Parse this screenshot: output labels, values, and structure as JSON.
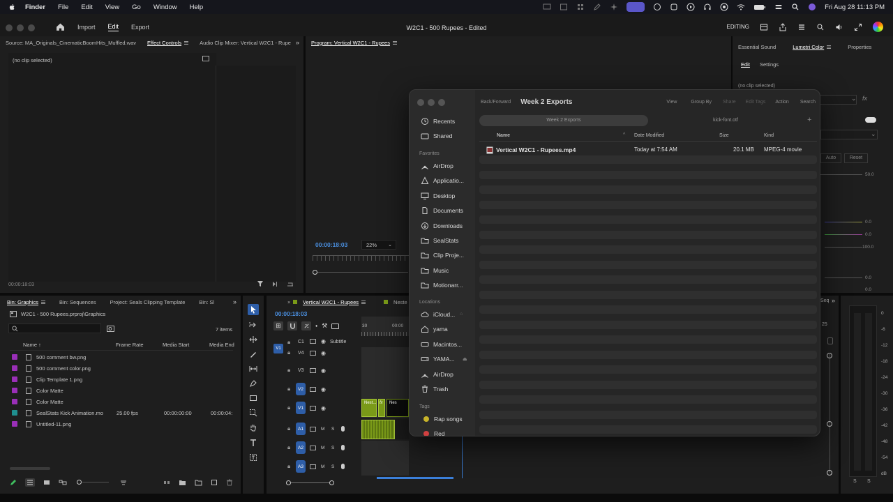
{
  "menubar": {
    "app": "Finder",
    "items": [
      "File",
      "Edit",
      "View",
      "Go",
      "Window",
      "Help"
    ],
    "clock": "Fri Aug 28  11:13 PM"
  },
  "header": {
    "nav": [
      "Import",
      "Edit",
      "Export"
    ],
    "active_nav": "Edit",
    "title": "W2C1 - 500 Rupees - Edited",
    "workspace": "EDITING"
  },
  "source_panel": {
    "tabs": [
      "Source: MA_Originals_CinematicBoomHits_Muffled.wav",
      "Effect Controls",
      "Audio Clip Mixer: Vertical W2C1 - Rupe"
    ],
    "active_tab": "Effect Controls",
    "no_clip": "(no clip selected)",
    "timecode": "00:00:18:03"
  },
  "program_panel": {
    "tab": "Program: Vertical W2C1 - Rupees",
    "timecode": "00:00:18:03",
    "zoom": "22%"
  },
  "lumetri_panel": {
    "tabs": [
      "Essential Sound",
      "Lumetri Color",
      "Properties"
    ],
    "active_tab": "Lumetri Color",
    "subtabs": [
      "Edit",
      "Settings"
    ],
    "no_clip": "(no clip selected)",
    "values": [
      "50.0",
      "0.0",
      "0.0",
      "100.0",
      "0.0",
      "0.0"
    ],
    "buttons": [
      "Auto",
      "Reset"
    ]
  },
  "project_panel": {
    "tabs": [
      "Bin: Graphics",
      "Bin: Sequences",
      "Project: Seals Clipping Template",
      "Bin: Sl"
    ],
    "path": "W2C1 - 500 Rupees.prproj\\Graphics",
    "item_count": "7 items",
    "columns": [
      "Name",
      "Frame Rate",
      "Media Start",
      "Media End"
    ],
    "rows": [
      {
        "name": "500 comment bw.png",
        "fps": "",
        "start": "",
        "end": "",
        "color": "#9a2fb8"
      },
      {
        "name": "500 comment color.png",
        "fps": "",
        "start": "",
        "end": "",
        "color": "#9a2fb8"
      },
      {
        "name": "Clip Template 1.png",
        "fps": "",
        "start": "",
        "end": "",
        "color": "#9a2fb8"
      },
      {
        "name": "Color Matte",
        "fps": "",
        "start": "",
        "end": "",
        "color": "#9a2fb8"
      },
      {
        "name": "Color Matte",
        "fps": "",
        "start": "",
        "end": "",
        "color": "#9a2fb8"
      },
      {
        "name": "SealStats Kick Animation.mo",
        "fps": "25.00 fps",
        "start": "00:00:00:00",
        "end": "00:00:04:",
        "color": "#1f8f8f"
      },
      {
        "name": "Untitled-11.png",
        "fps": "",
        "start": "",
        "end": "",
        "color": "#9a2fb8"
      }
    ]
  },
  "timeline_panel": {
    "tabs": [
      "Vertical W2C1 - Rupees",
      "Neste"
    ],
    "timecode": "00:00:18:03",
    "ruler": [
      "30",
      "00:00"
    ],
    "tracks": [
      {
        "label": "C1",
        "name": "Subtitle"
      },
      {
        "label": "V4"
      },
      {
        "label": "V3"
      },
      {
        "label": "V2"
      },
      {
        "label": "V1"
      },
      {
        "label": "A1"
      },
      {
        "label": "A2"
      },
      {
        "label": "A3"
      }
    ],
    "clips": [
      "Nest...",
      "Nes"
    ],
    "right_partial": [
      "Seq",
      "25"
    ]
  },
  "audio_meter": {
    "scale": [
      "0",
      "-6",
      "-12",
      "-18",
      "-24",
      "-30",
      "-36",
      "-42",
      "-48",
      "-54",
      "dB"
    ],
    "channels": [
      "S",
      "S"
    ]
  },
  "finder": {
    "toolbar": {
      "back": "Back/Forward",
      "title": "Week 2 Exports",
      "buttons": [
        "View",
        "Group By",
        "Share",
        "Edit Tags",
        "Action",
        "Search"
      ]
    },
    "tabs": [
      "Week 2 Exports",
      "kick-font.otf"
    ],
    "columns": [
      "Name",
      "Date Modified",
      "Size",
      "Kind"
    ],
    "file": {
      "name": "Vertical W2C1 - Rupees.mp4",
      "modified": "Today at 7:54 AM",
      "size": "20.1 MB",
      "kind": "MPEG-4 movie"
    },
    "sidebar_top": [
      {
        "label": "Recents",
        "icon": "clock-icon"
      },
      {
        "label": "Shared",
        "icon": "shared-folder-icon"
      }
    ],
    "favorites_title": "Favorites",
    "favorites": [
      {
        "label": "AirDrop",
        "icon": "airdrop-icon"
      },
      {
        "label": "Applicatio...",
        "icon": "applications-icon"
      },
      {
        "label": "Desktop",
        "icon": "desktop-icon"
      },
      {
        "label": "Documents",
        "icon": "document-icon"
      },
      {
        "label": "Downloads",
        "icon": "download-icon"
      },
      {
        "label": "SealStats",
        "icon": "folder-icon"
      },
      {
        "label": "Clip Proje...",
        "icon": "folder-icon"
      },
      {
        "label": "Music",
        "icon": "folder-icon"
      },
      {
        "label": "Motionarr...",
        "icon": "folder-icon"
      }
    ],
    "locations_title": "Locations",
    "locations": [
      {
        "label": "iCloud...",
        "icon": "cloud-icon"
      },
      {
        "label": "yama",
        "icon": "home-icon"
      },
      {
        "label": "Macintos...",
        "icon": "disk-icon"
      },
      {
        "label": "YAMA...",
        "icon": "drive-icon"
      },
      {
        "label": "AirDrop",
        "icon": "airdrop-icon"
      },
      {
        "label": "Trash",
        "icon": "trash-icon"
      }
    ],
    "tags_title": "Tags",
    "tags": [
      {
        "label": "Rap songs",
        "color": "#c8b42a"
      },
      {
        "label": "Red",
        "color": "#d04040"
      }
    ]
  },
  "colors": {
    "accent_blue": "#4a8fe0",
    "track_blue": "#2e5ea8",
    "clip_green": "#7a9a18",
    "playhead": "#3b7fd9"
  }
}
